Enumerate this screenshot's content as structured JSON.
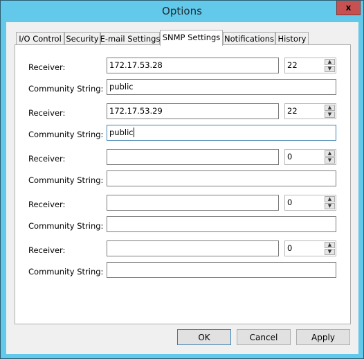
{
  "window": {
    "title": "Options",
    "close_glyph": "x"
  },
  "tabs": [
    {
      "label": "I/O Control",
      "active": false
    },
    {
      "label": "Security",
      "active": false
    },
    {
      "label": "E-mail Settings",
      "active": false
    },
    {
      "label": "SNMP Settings",
      "active": true
    },
    {
      "label": "Notifications",
      "active": false
    },
    {
      "label": "History",
      "active": false
    }
  ],
  "snmp": {
    "receiver_label": "Receiver:",
    "community_label": "Community String:",
    "entries": [
      {
        "receiver": "172.17.53.28",
        "port": "22",
        "community": "public"
      },
      {
        "receiver": "172.17.53.29",
        "port": "22",
        "community": "public"
      },
      {
        "receiver": "",
        "port": "0",
        "community": ""
      },
      {
        "receiver": "",
        "port": "0",
        "community": ""
      },
      {
        "receiver": "",
        "port": "0",
        "community": ""
      }
    ]
  },
  "icons": {
    "spin_up": "▲",
    "spin_down": "▼"
  },
  "buttons": {
    "ok": "OK",
    "cancel": "Cancel",
    "apply": "Apply"
  }
}
